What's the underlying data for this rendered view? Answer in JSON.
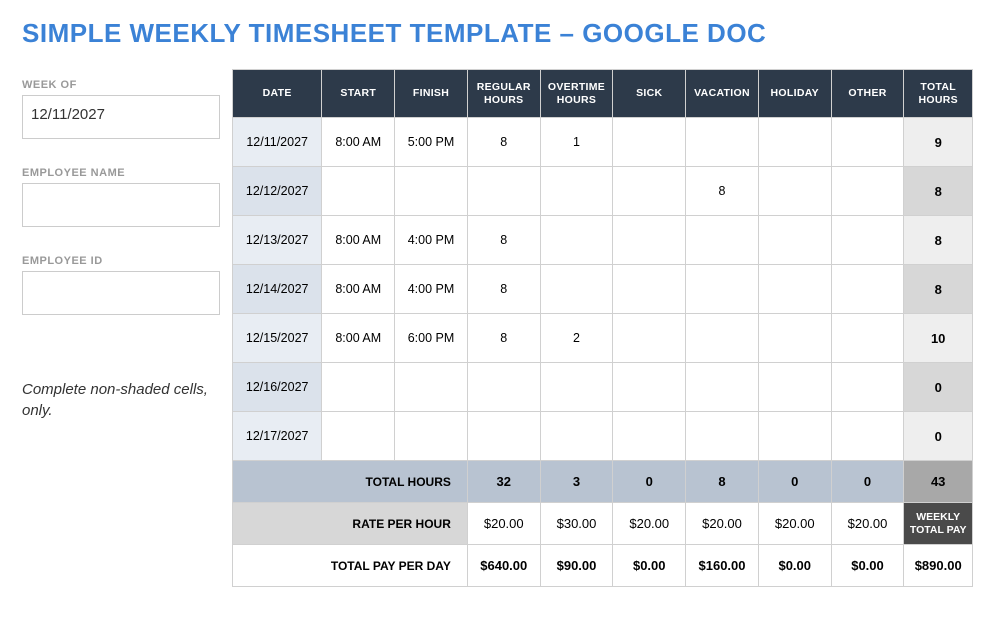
{
  "title": "SIMPLE WEEKLY TIMESHEET TEMPLATE – GOOGLE DOC",
  "sidebar": {
    "week_of_label": "WEEK OF",
    "week_of_value": "12/11/2027",
    "employee_name_label": "EMPLOYEE NAME",
    "employee_name_value": "",
    "employee_id_label": "EMPLOYEE ID",
    "employee_id_value": "",
    "note": "Complete non-shaded cells, only."
  },
  "headers": {
    "date": "DATE",
    "start": "START",
    "finish": "FINISH",
    "regular": "REGULAR HOURS",
    "overtime": "OVERTIME HOURS",
    "sick": "SICK",
    "vacation": "VACATION",
    "holiday": "HOLIDAY",
    "other": "OTHER",
    "total": "TOTAL HOURS"
  },
  "rows": [
    {
      "date": "12/11/2027",
      "start": "8:00 AM",
      "finish": "5:00 PM",
      "regular": "8",
      "overtime": "1",
      "sick": "",
      "vacation": "",
      "holiday": "",
      "other": "",
      "total": "9"
    },
    {
      "date": "12/12/2027",
      "start": "",
      "finish": "",
      "regular": "",
      "overtime": "",
      "sick": "",
      "vacation": "8",
      "holiday": "",
      "other": "",
      "total": "8"
    },
    {
      "date": "12/13/2027",
      "start": "8:00 AM",
      "finish": "4:00 PM",
      "regular": "8",
      "overtime": "",
      "sick": "",
      "vacation": "",
      "holiday": "",
      "other": "",
      "total": "8"
    },
    {
      "date": "12/14/2027",
      "start": "8:00 AM",
      "finish": "4:00 PM",
      "regular": "8",
      "overtime": "",
      "sick": "",
      "vacation": "",
      "holiday": "",
      "other": "",
      "total": "8"
    },
    {
      "date": "12/15/2027",
      "start": "8:00 AM",
      "finish": "6:00 PM",
      "regular": "8",
      "overtime": "2",
      "sick": "",
      "vacation": "",
      "holiday": "",
      "other": "",
      "total": "10"
    },
    {
      "date": "12/16/2027",
      "start": "",
      "finish": "",
      "regular": "",
      "overtime": "",
      "sick": "",
      "vacation": "",
      "holiday": "",
      "other": "",
      "total": "0"
    },
    {
      "date": "12/17/2027",
      "start": "",
      "finish": "",
      "regular": "",
      "overtime": "",
      "sick": "",
      "vacation": "",
      "holiday": "",
      "other": "",
      "total": "0"
    }
  ],
  "footer": {
    "total_hours_label": "TOTAL HOURS",
    "totals": {
      "regular": "32",
      "overtime": "3",
      "sick": "0",
      "vacation": "8",
      "holiday": "0",
      "other": "0",
      "grand": "43"
    },
    "rate_label": "RATE PER HOUR",
    "rates": {
      "regular": "$20.00",
      "overtime": "$30.00",
      "sick": "$20.00",
      "vacation": "$20.00",
      "holiday": "$20.00",
      "other": "$20.00"
    },
    "weekly_total_pay_label": "WEEKLY TOTAL PAY",
    "total_pay_label": "TOTAL PAY PER DAY",
    "pays": {
      "regular": "$640.00",
      "overtime": "$90.00",
      "sick": "$0.00",
      "vacation": "$160.00",
      "holiday": "$0.00",
      "other": "$0.00",
      "grand": "$890.00"
    }
  }
}
